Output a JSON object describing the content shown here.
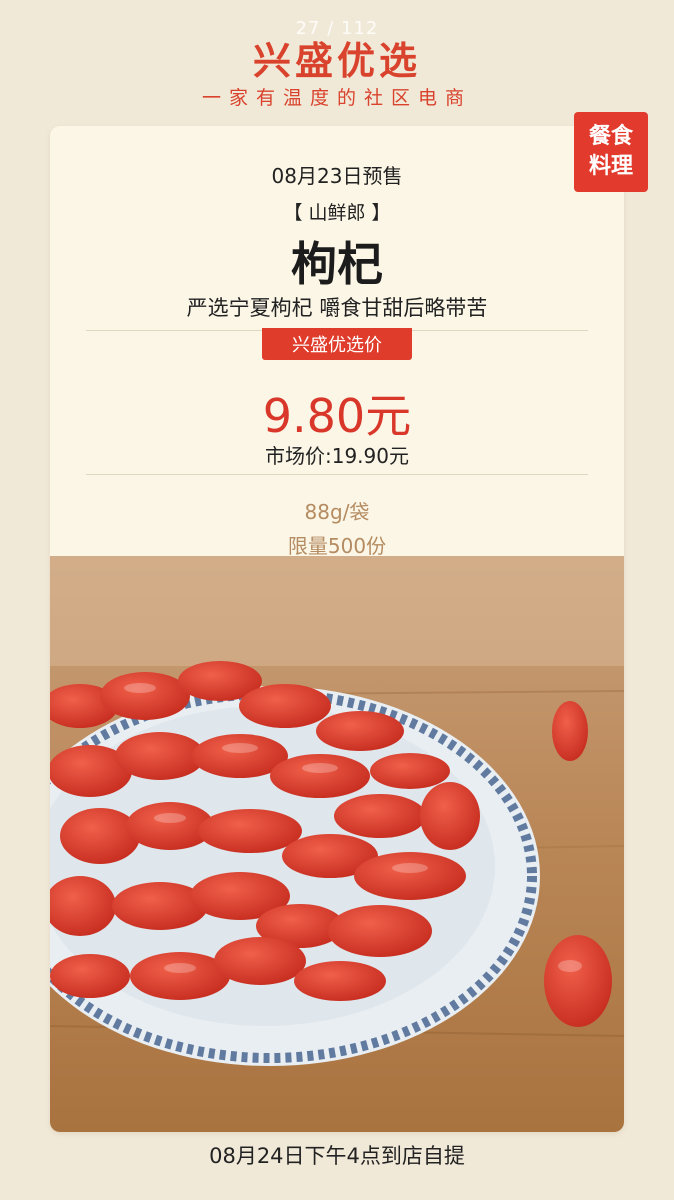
{
  "header": {
    "page_counter": "27 / 112",
    "brand": "兴盛优选",
    "slogan": "一家有温度的社区电商"
  },
  "product": {
    "category_line1": "餐食",
    "category_line2": "料理",
    "presale_date": "08月23日预售",
    "supplier": "【 山鲜郎 】",
    "name": "枸杞",
    "description": "严选宁夏枸杞 嚼食甘甜后略带苦",
    "price_label": "兴盛优选价",
    "price": "9.80元",
    "market_price": "市场价:19.90元",
    "spec": "88g/袋",
    "limit": "限量500份",
    "image_icon": "goji-berry-photo"
  },
  "footer": {
    "pickup": "08月24日下午4点到店自提"
  },
  "colors": {
    "brand_red": "#d9432d",
    "background": "#f1e9d8",
    "card": "#fbf6e6",
    "spec_text": "#b58c62"
  }
}
